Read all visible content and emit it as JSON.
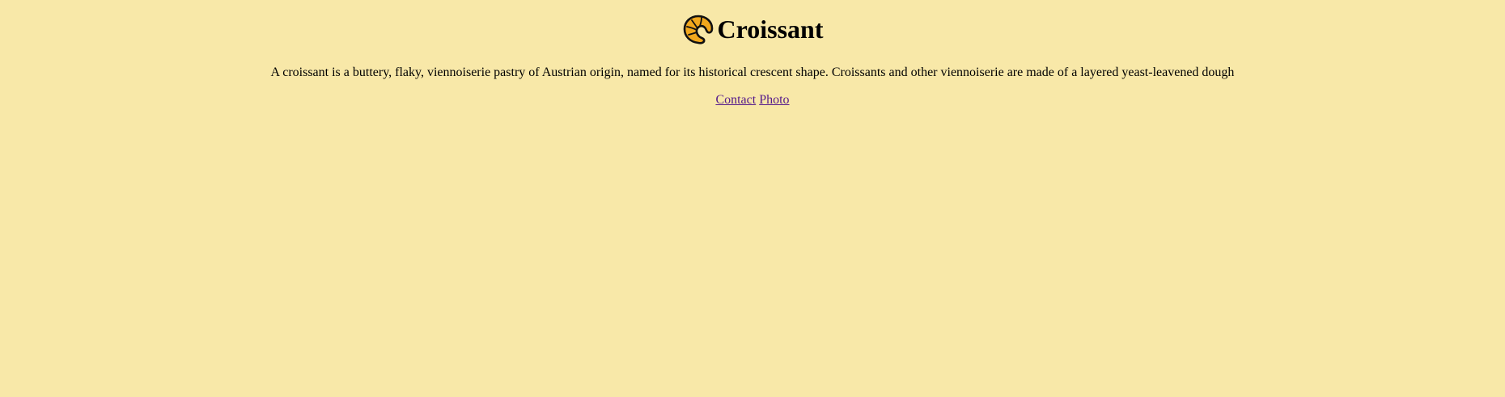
{
  "page": {
    "background": "#f8e8a8",
    "heading": "Croissant",
    "logo_icon": "croissant-icon",
    "description": "A croissant is a buttery, flaky, viennoiserie pastry of Austrian origin, named for its historical crescent shape. Croissants and other viennoiserie are made of a layered yeast-leavened dough",
    "links": [
      {
        "label": "Contact"
      },
      {
        "label": "Photo"
      }
    ],
    "link_color": "#551a8b"
  }
}
